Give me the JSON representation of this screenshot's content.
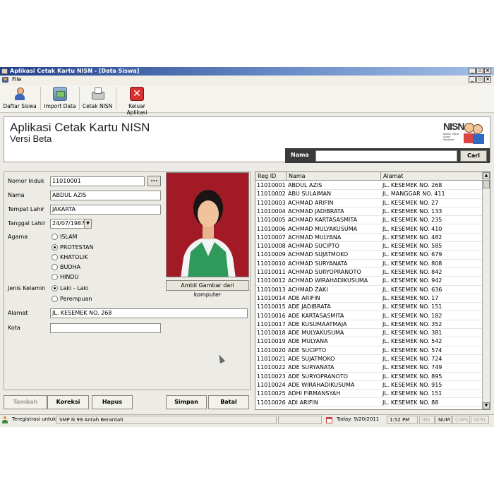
{
  "window": {
    "title": "Aplikasi Cetak Kartu NISN - [Data Siswa]",
    "menu": [
      "File"
    ]
  },
  "toolbar": {
    "daftar_siswa": "Daftar Siswa",
    "import_data": "Import Data",
    "cetak_nisn": "Cetak NISN",
    "keluar": "Keluar Aplikasi"
  },
  "header": {
    "title": "Aplikasi Cetak Kartu NISN",
    "subtitle": "Versi Beta",
    "logo_text": "NISN",
    "logo_sub": "Nomor Induk Siswa Nasional",
    "search_label": "Nama",
    "search_value": "",
    "search_button": "Cari"
  },
  "form": {
    "nomor_induk_label": "Nomor Induk",
    "nomor_induk": "11010001",
    "browse_button": "...",
    "nama_label": "Nama",
    "nama": "ABDUL AZIS",
    "tempat_lahir_label": "Tempat Lahir",
    "tempat_lahir": "JAKARTA",
    "tanggal_lahir_label": "Tanggal Lahir",
    "tanggal_lahir": "24/07/1987",
    "agama_label": "Agama",
    "agama_options": [
      "ISLAM",
      "PROTESTAN",
      "KHATOLIK",
      "BUDHA",
      "HINDU"
    ],
    "agama_selected": "PROTESTAN",
    "jenis_kelamin_label": "Jenis Kelamin",
    "jk_options": [
      "Laki - Laki",
      "Perempuan"
    ],
    "jk_selected": "Laki - Laki",
    "alamat_label": "Alamat",
    "alamat": "JL. KESEMEK NO. 268",
    "kota_label": "Kota",
    "kota": "",
    "photo_button": "Ambil Gambar dari komputer"
  },
  "buttons": {
    "tambah": "Tambah",
    "koreksi": "Koreksi",
    "hapus": "Hapus",
    "simpan": "Simpan",
    "batal": "Batal"
  },
  "grid": {
    "columns": [
      "Reg ID",
      "Nama",
      "Alamat"
    ],
    "rows": [
      [
        "11010001",
        "ABDUL AZIS",
        "JL. KESEMEK NO. 268"
      ],
      [
        "11010002",
        "ABU SULAIMAN",
        "JL. MANGGAR NO. 411"
      ],
      [
        "11010003",
        "ACHMAD ARIFIN",
        "JL. KESEMEK NO. 27"
      ],
      [
        "11010004",
        "ACHMAD JADIBRATA",
        "JL. KESEMEK NO. 133"
      ],
      [
        "11010005",
        "ACHMAD KARTASASMITA",
        "JL. KESEMEK NO. 235"
      ],
      [
        "11010006",
        "ACHMAD MULYAKUSUMA",
        "JL. KESEMEK NO. 410"
      ],
      [
        "11010007",
        "ACHMAD MULYANA",
        "JL. KESEMEK NO. 482"
      ],
      [
        "11010008",
        "ACHMAD SUCIPTO",
        "JL. KESEMEK NO. 585"
      ],
      [
        "11010009",
        "ACHMAD SUJATMOKO",
        "JL. KESEMEK NO. 679"
      ],
      [
        "11010010",
        "ACHMAD SURYANATA",
        "JL. KESEMEK NO. 808"
      ],
      [
        "11010011",
        "ACHMAD SURYOPRANOTO",
        "JL. KESEMEK NO. 842"
      ],
      [
        "11010012",
        "ACHMAD WIRAHADIKUSUMA",
        "JL. KESEMEK NO. 942"
      ],
      [
        "11010013",
        "ACHMAD ZAKI",
        "JL. KESEMEK NO. 636"
      ],
      [
        "11010014",
        "ADE ARIFIN",
        "JL. KESEMEK NO. 17"
      ],
      [
        "11010015",
        "ADE JADIBRATA",
        "JL. KESEMEK NO. 151"
      ],
      [
        "11010016",
        "ADE KARTASASMITA",
        "JL. KESEMEK NO. 182"
      ],
      [
        "11010017",
        "ADE KUSUMAATMAJA",
        "JL. KESEMEK NO. 352"
      ],
      [
        "11010018",
        "ADE MULYAKUSUMA",
        "JL. KESEMEK NO. 381"
      ],
      [
        "11010019",
        "ADE MULYANA",
        "JL. KESEMEK NO. 542"
      ],
      [
        "11010020",
        "ADE SUCIPTO",
        "JL. KESEMEK NO. 574"
      ],
      [
        "11010021",
        "ADE SUJATMOKO",
        "JL. KESEMEK NO. 724"
      ],
      [
        "11010022",
        "ADE SURYANATA",
        "JL. KESEMEK NO. 749"
      ],
      [
        "11010023",
        "ADE SURYOPRANOTO",
        "JL. KESEMEK NO. 895"
      ],
      [
        "11010024",
        "ADE WIRAHADIKUSUMA",
        "JL. KESEMEK NO. 915"
      ],
      [
        "11010025",
        "ADHI FIRMANSYAH",
        "JL. KESEMEK NO. 151"
      ],
      [
        "11010026",
        "ADI ARIFIN",
        "JL. KESEMEK NO. 88"
      ]
    ]
  },
  "status": {
    "user_label": "Teregistrasi untuk :",
    "user_value": "SMP N 99 Antah Berantah",
    "today": "Today:  9/20/2011",
    "time": "1:52 PM",
    "ins": "INS",
    "num": "NUM",
    "caps": "CAPS",
    "scrl": "SCRL"
  },
  "colors": {
    "title_bar": "#1f3f8a",
    "search_bar": "#3a3a3a",
    "photo_bg": "#a11a26"
  }
}
